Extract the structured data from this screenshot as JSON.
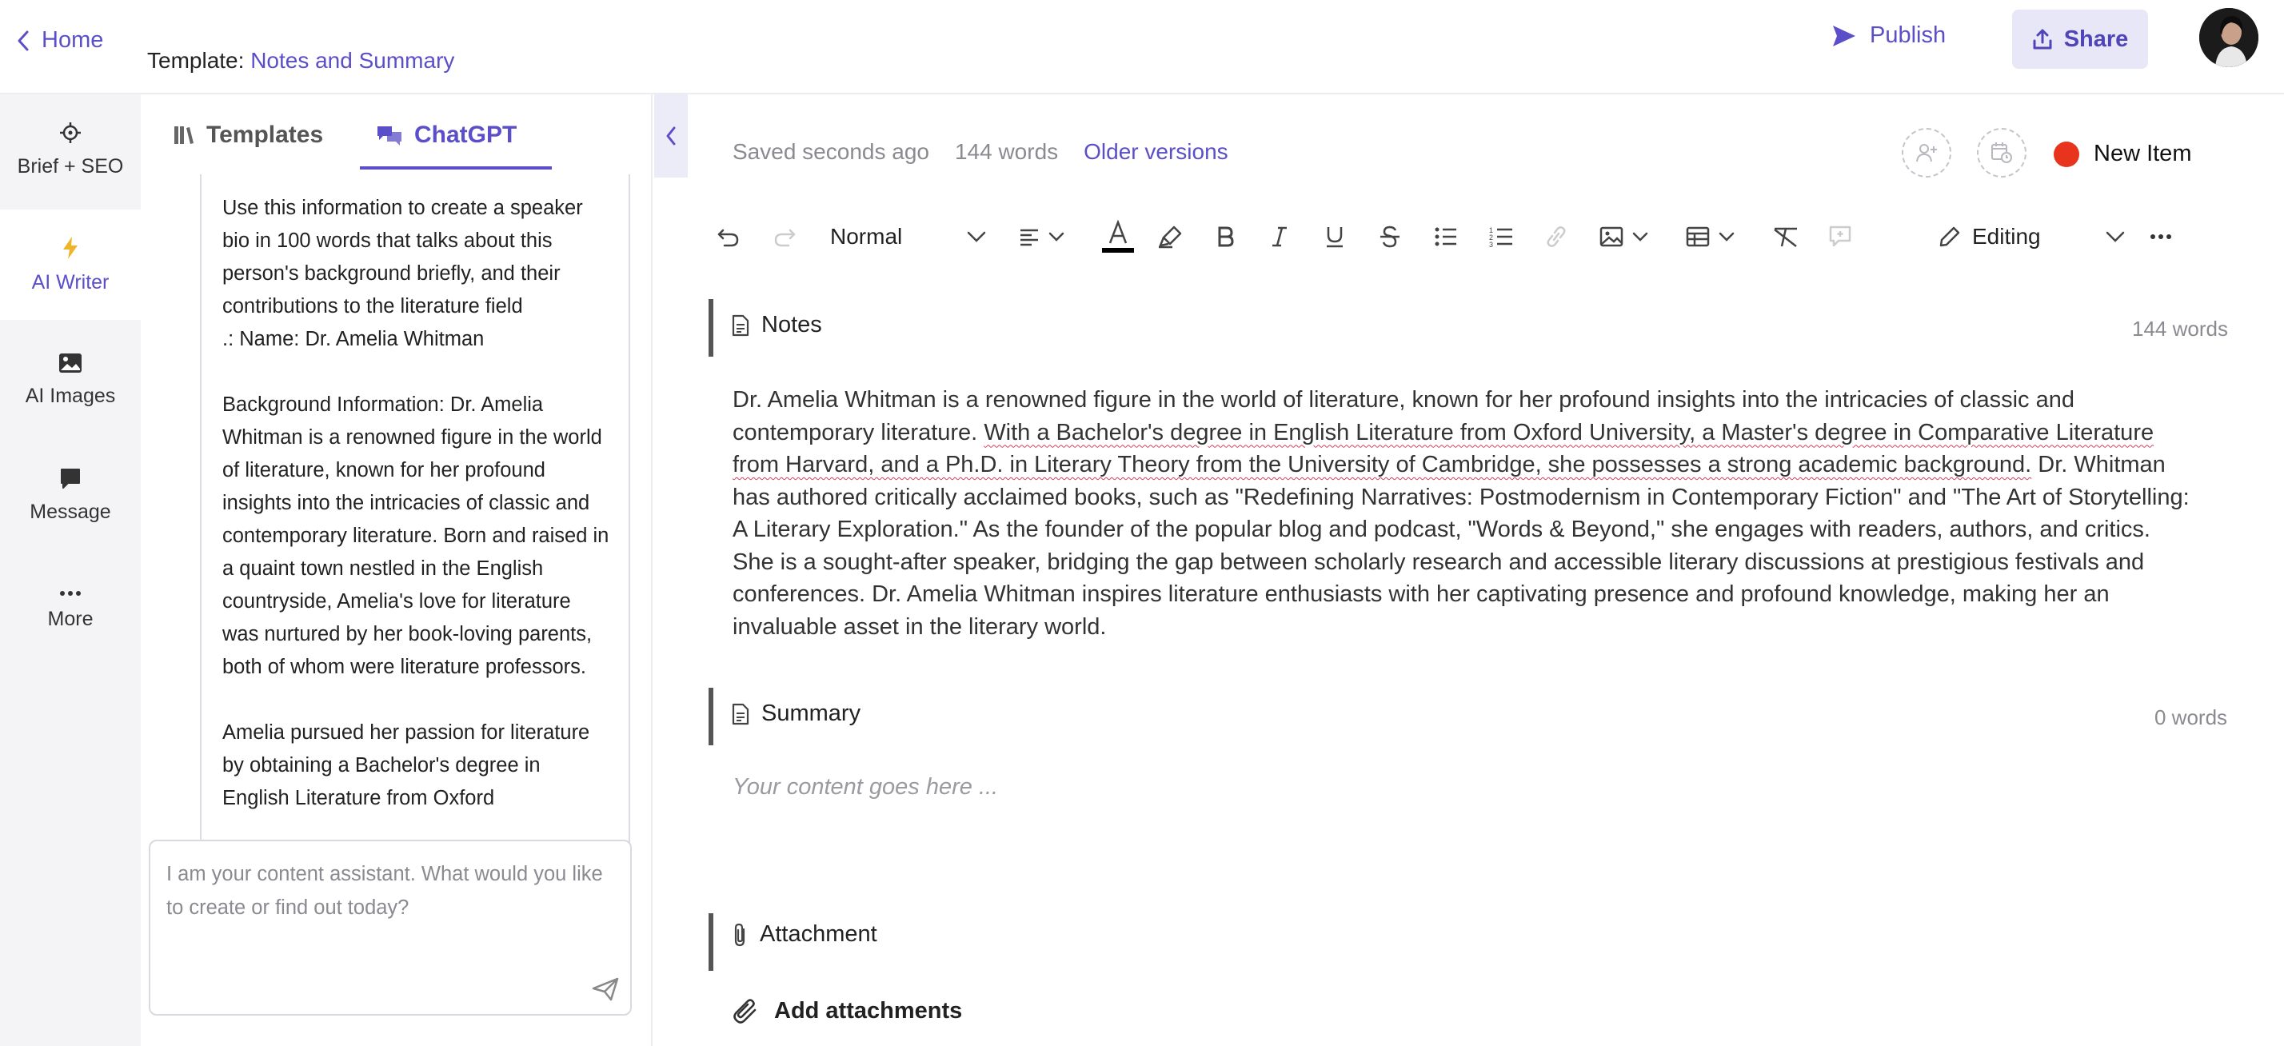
{
  "topbar": {
    "home_label": "Home",
    "template_prefix": "Template:",
    "template_name": "Notes and Summary",
    "publish_label": "Publish",
    "share_label": "Share"
  },
  "rail": {
    "items": [
      {
        "label": "Brief + SEO",
        "icon": "crosshair-icon"
      },
      {
        "label": "AI Writer",
        "icon": "lightning-icon",
        "active": true
      },
      {
        "label": "AI Images",
        "icon": "image-icon"
      },
      {
        "label": "Message",
        "icon": "chat-bubble-icon"
      },
      {
        "label": "More",
        "icon": "ellipsis-icon"
      }
    ]
  },
  "panel": {
    "tabs": [
      {
        "label": "Templates",
        "icon": "library-icon"
      },
      {
        "label": "ChatGPT",
        "icon": "chat-icon",
        "active": true
      }
    ],
    "chat_message": "Use this information to create a speaker bio in 100 words that talks about this person's background briefly, and their contributions to the literature field\n.: Name: Dr. Amelia Whitman\n\nBackground Information: Dr. Amelia Whitman is a renowned figure in the world of literature, known for her profound insights into the intricacies of classic and contemporary literature. Born and raised in a quaint town nestled in the English countryside, Amelia's love for literature was nurtured by her book-loving parents, both of whom were literature professors.\n\nAmelia pursued her passion for literature by obtaining a Bachelor's degree in English Literature from Oxford",
    "prompt_placeholder": "I am your content assistant. What would you like to create or find out today?"
  },
  "editor": {
    "saved_status": "Saved seconds ago",
    "word_count": "144 words",
    "older_versions": "Older versions",
    "new_item_label": "New Item",
    "toolbar": {
      "style_select": "Normal",
      "mode_select": "Editing",
      "text_color": "#000000"
    },
    "sections": {
      "notes": {
        "title": "Notes",
        "count": "144 words",
        "body_part1": "Dr. Amelia Whitman is a renowned figure in the world of literature, known for her profound insights into the intricacies of classic and contemporary literature. ",
        "body_part2": "With a Bachelor's degree in English Literature from Oxford University, a Master's degree in Comparative Literature from Harvard, and a Ph.D. in Literary Theory from the University of Cambridge, she possesses a strong academic background.",
        "body_part3": " Dr. Whitman has authored critically acclaimed books, such as \"Redefining Narratives: Postmodernism in Contemporary Fiction\" and \"The Art of Storytelling: A Literary Exploration.\" As the founder of the popular blog and podcast, \"Words & Beyond,\" she engages with readers, authors, and critics. She is a sought-after speaker, bridging the gap between scholarly research and accessible literary discussions at prestigious festivals and conferences. Dr. Amelia Whitman inspires literature enthusiasts with her captivating presence and profound knowledge, making her an invaluable asset in the literary world."
      },
      "summary": {
        "title": "Summary",
        "count": "0 words",
        "placeholder": "Your content goes here ..."
      },
      "attachment": {
        "title": "Attachment",
        "add_label": "Add attachments"
      }
    }
  },
  "colors": {
    "accent": "#5b4fc9",
    "share_bg": "#e8e7f8",
    "new_item_dot": "#e8341c",
    "rail_bg": "#f4f4f6"
  }
}
